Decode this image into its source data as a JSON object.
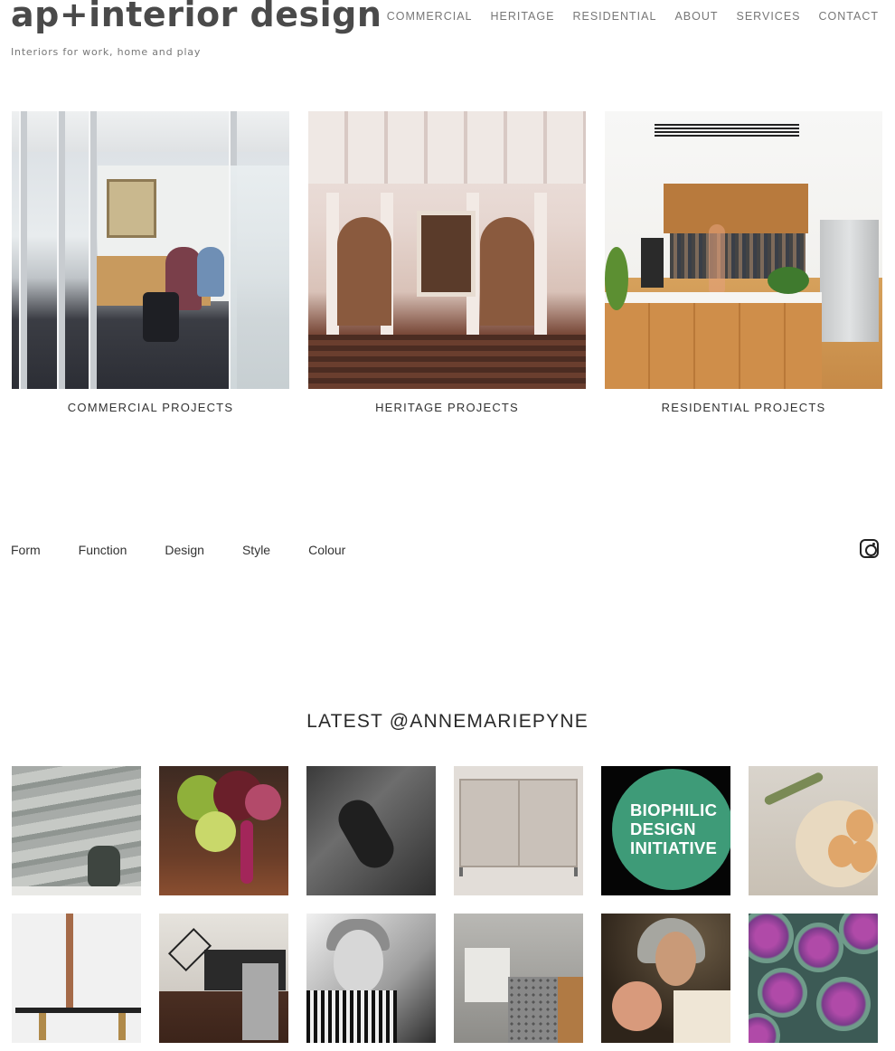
{
  "header": {
    "logo": "ap+interior design",
    "tagline": "Interiors for work, home and play",
    "nav": [
      "COMMERCIAL",
      "HERITAGE",
      "RESIDENTIAL",
      "ABOUT",
      "SERVICES",
      "CONTACT"
    ]
  },
  "projects": [
    {
      "caption": "COMMERCIAL PROJECTS"
    },
    {
      "caption": "HERITAGE PROJECTS"
    },
    {
      "caption": "RESIDENTIAL PROJECTS"
    }
  ],
  "tags": [
    "Form",
    "Function",
    "Design",
    "Style",
    "Colour"
  ],
  "feed": {
    "title": "LATEST @ANNEMARIEPYNE",
    "biophilic_text": [
      "BIOPHILIC",
      "DESIGN",
      "INITIATIVE"
    ]
  },
  "icons": {
    "social": "instagram-icon"
  }
}
